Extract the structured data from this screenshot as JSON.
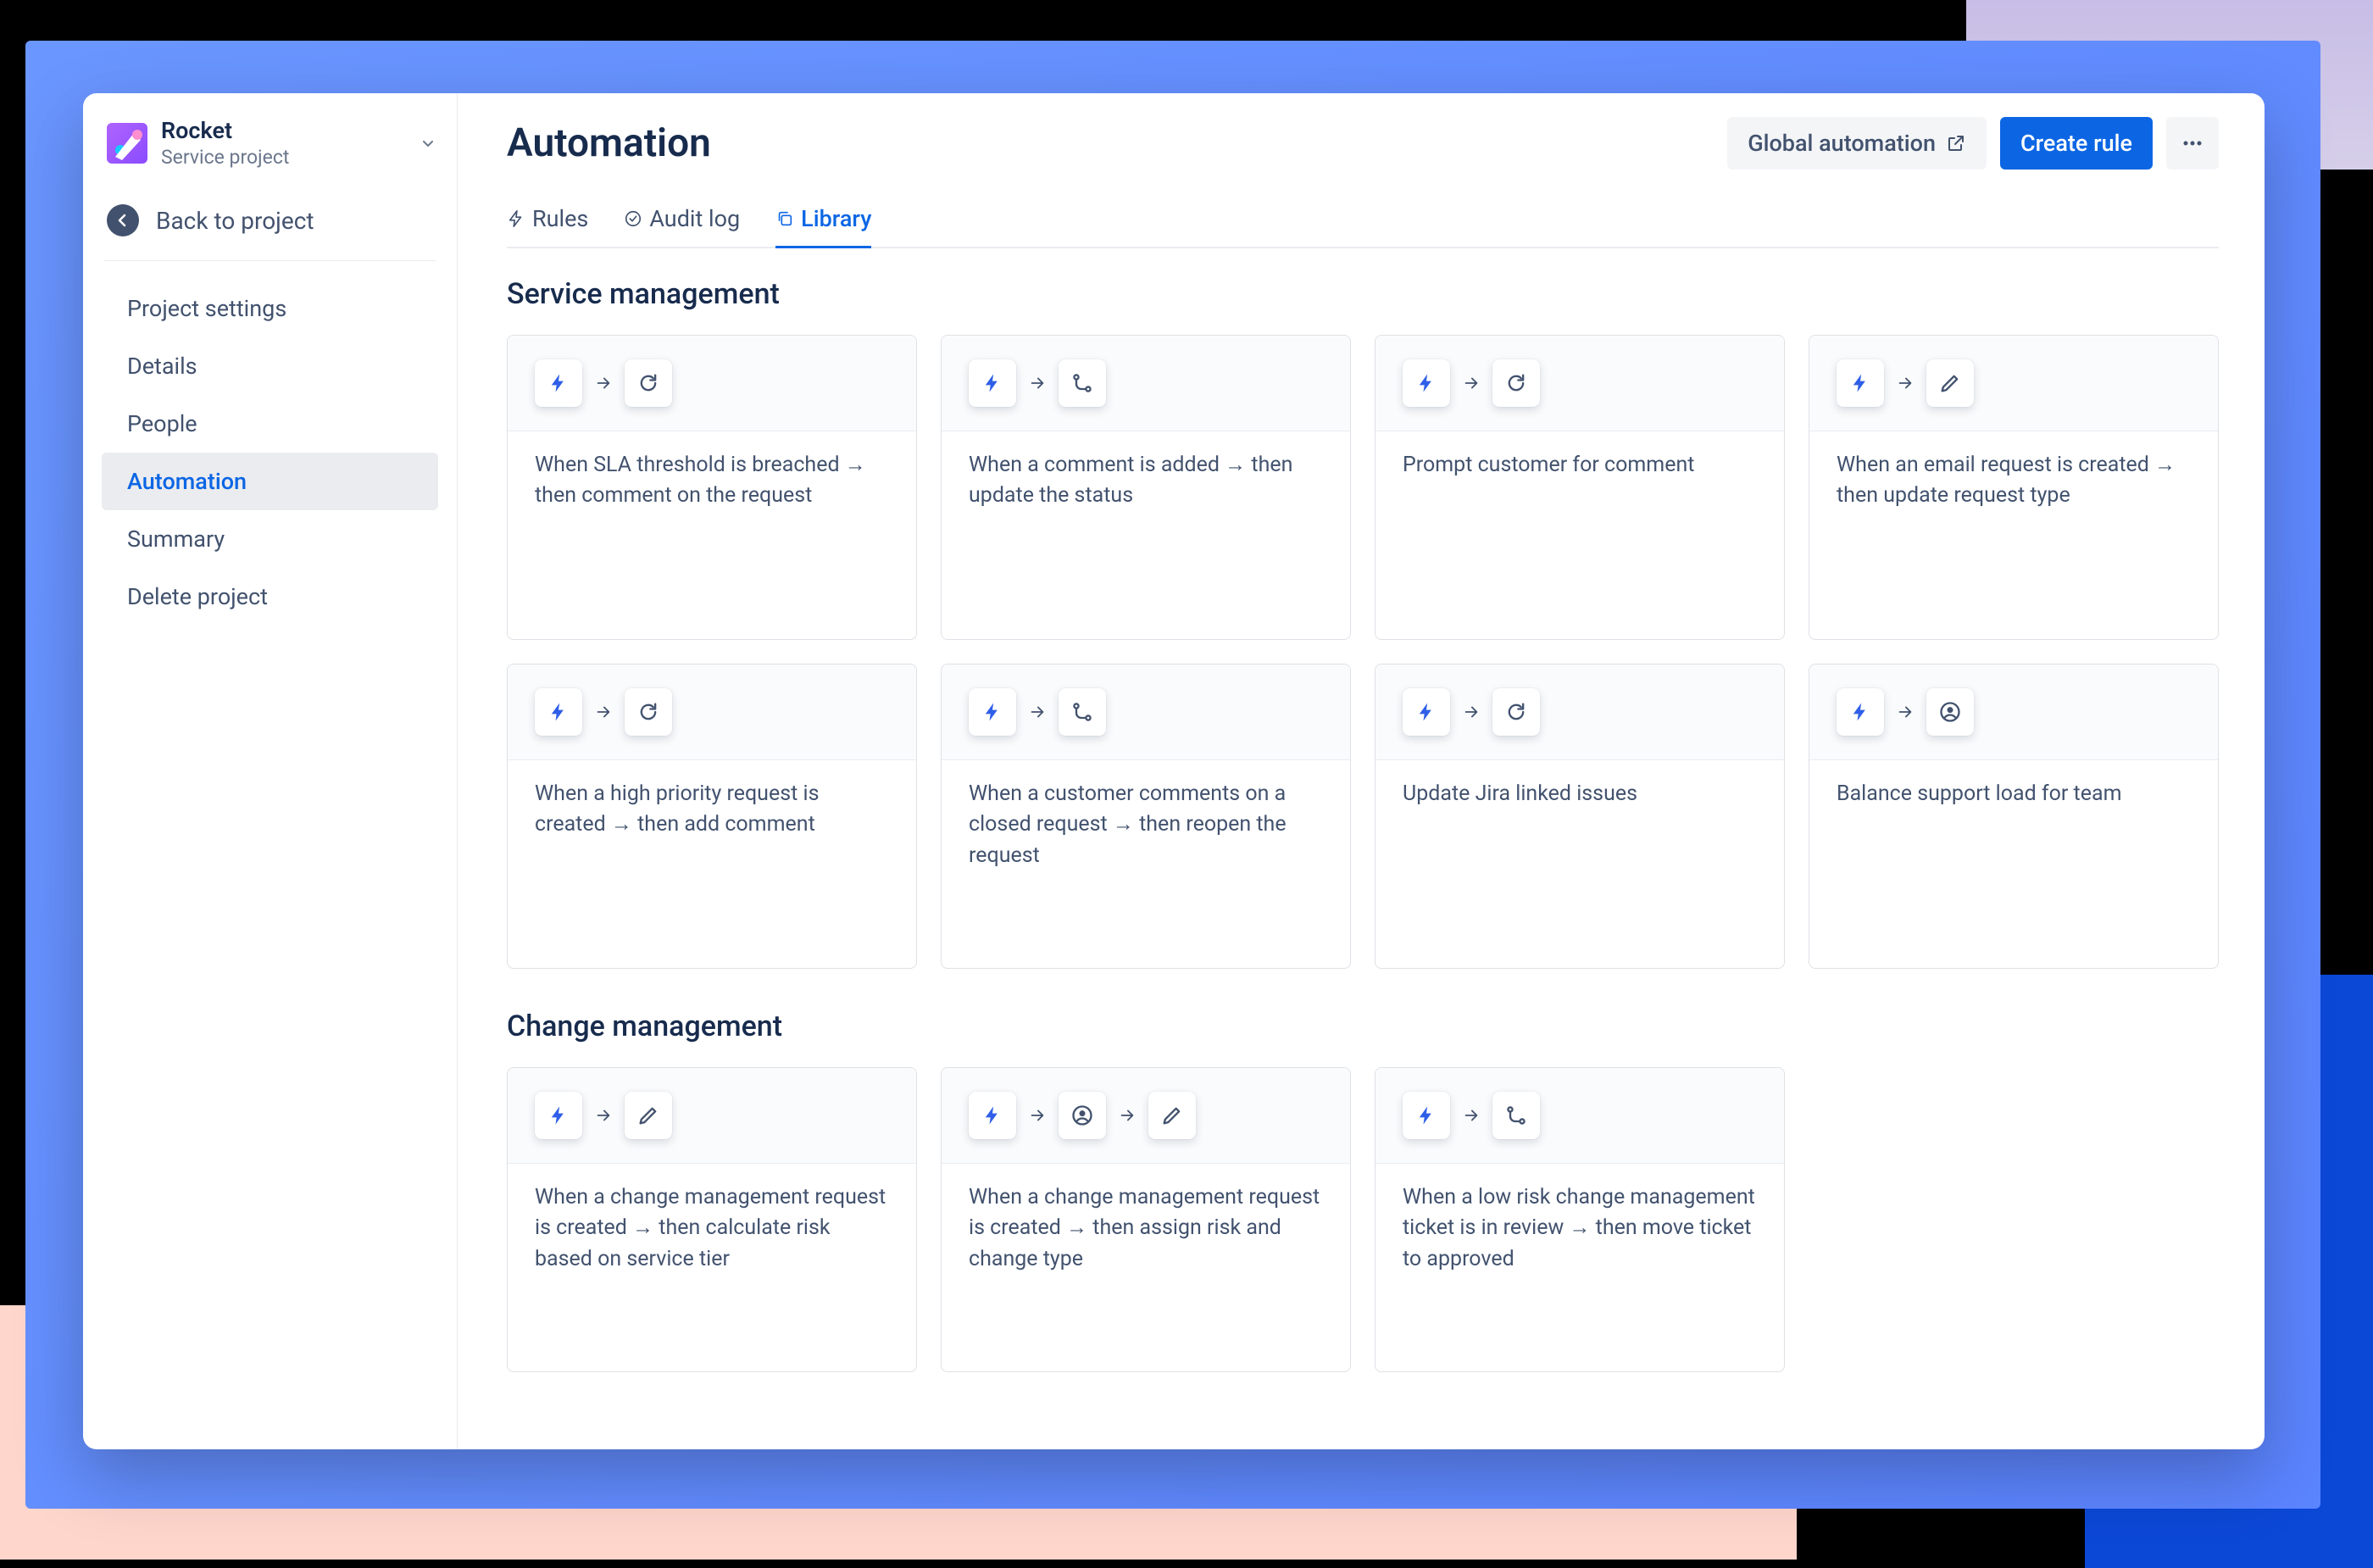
{
  "sidebar": {
    "project": {
      "name": "Rocket",
      "type": "Service project"
    },
    "back_label": "Back to project",
    "items": [
      {
        "label": "Project settings"
      },
      {
        "label": "Details"
      },
      {
        "label": "People"
      },
      {
        "label": "Automation",
        "active": true
      },
      {
        "label": "Summary"
      },
      {
        "label": "Delete project"
      }
    ]
  },
  "header": {
    "title": "Automation",
    "global_btn": "Global automation",
    "create_btn": "Create rule"
  },
  "tabs": [
    {
      "label": "Rules"
    },
    {
      "label": "Audit log"
    },
    {
      "label": "Library",
      "active": true
    }
  ],
  "sections": {
    "service": {
      "title": "Service management",
      "cards": [
        {
          "text": "When SLA threshold is breached → then comment on the request",
          "icons": [
            "bolt",
            "refresh"
          ]
        },
        {
          "text": "When a comment is added → then update the status",
          "icons": [
            "bolt",
            "branch"
          ]
        },
        {
          "text": "Prompt customer for comment",
          "icons": [
            "bolt",
            "refresh"
          ]
        },
        {
          "text": "When an email request is created → then update request type",
          "icons": [
            "bolt",
            "pencil"
          ]
        },
        {
          "text": "When a high priority request is created → then add comment",
          "icons": [
            "bolt",
            "refresh"
          ]
        },
        {
          "text": "When a customer comments on a closed request → then reopen the request",
          "icons": [
            "bolt",
            "branch"
          ]
        },
        {
          "text": "Update Jira linked issues",
          "icons": [
            "bolt",
            "refresh"
          ]
        },
        {
          "text": "Balance support load for team",
          "icons": [
            "bolt",
            "person"
          ]
        }
      ]
    },
    "change": {
      "title": "Change management",
      "cards": [
        {
          "text": "When a change management request is created → then calculate risk based on service tier",
          "icons": [
            "bolt",
            "pencil"
          ]
        },
        {
          "text": "When a change management request is created → then assign risk and change type",
          "icons": [
            "bolt",
            "person",
            "pencil"
          ]
        },
        {
          "text": "When a low risk change management ticket is in review → then move ticket to approved",
          "icons": [
            "bolt",
            "branch"
          ]
        }
      ]
    }
  }
}
